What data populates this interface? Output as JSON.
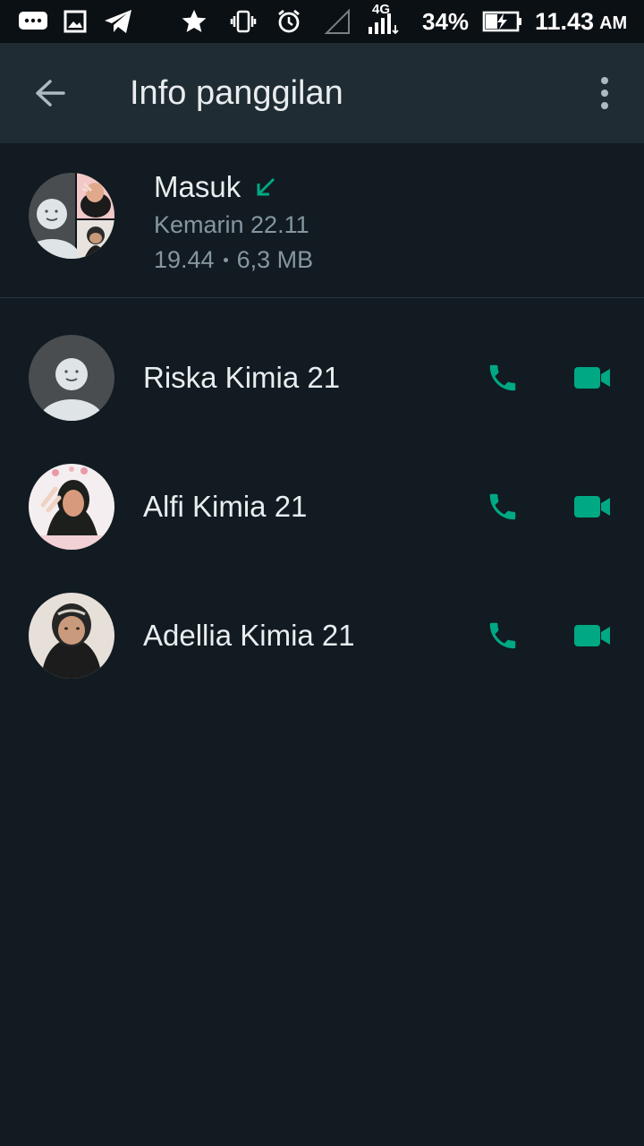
{
  "status_bar": {
    "network": "4G",
    "battery": "34%",
    "time": "11.43",
    "ampm": "AM",
    "icons": [
      "messages-icon",
      "gallery-icon",
      "telegram-icon",
      "star-icon",
      "vibrate-icon",
      "alarm-icon",
      "no-signal-icon",
      "signal-icon",
      "battery-charging-icon"
    ]
  },
  "appbar": {
    "title": "Info panggilan",
    "back_icon": "arrow-back-icon",
    "menu_icon": "more-vert-icon"
  },
  "call_summary": {
    "type": "Masuk",
    "direction_icon": "incoming-arrow-icon",
    "date": "Kemarin 22.11",
    "duration": "19.44",
    "size": "6,3 MB"
  },
  "participants": [
    {
      "name": "Riska Kimia 21",
      "avatar": "default-avatar"
    },
    {
      "name": "Alfi Kimia 21",
      "avatar": "photo-avatar"
    },
    {
      "name": "Adellia Kimia 21",
      "avatar": "photo-avatar"
    }
  ],
  "colors": {
    "background": "#111b21",
    "appbar": "#202c33",
    "accent": "#00a884",
    "text_primary": "#e9edef",
    "text_secondary": "#8696a0"
  }
}
